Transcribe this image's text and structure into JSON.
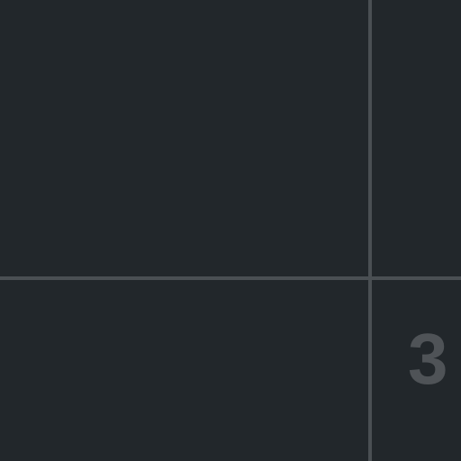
{
  "panes": {
    "bottom_right": {
      "number": "3"
    }
  }
}
